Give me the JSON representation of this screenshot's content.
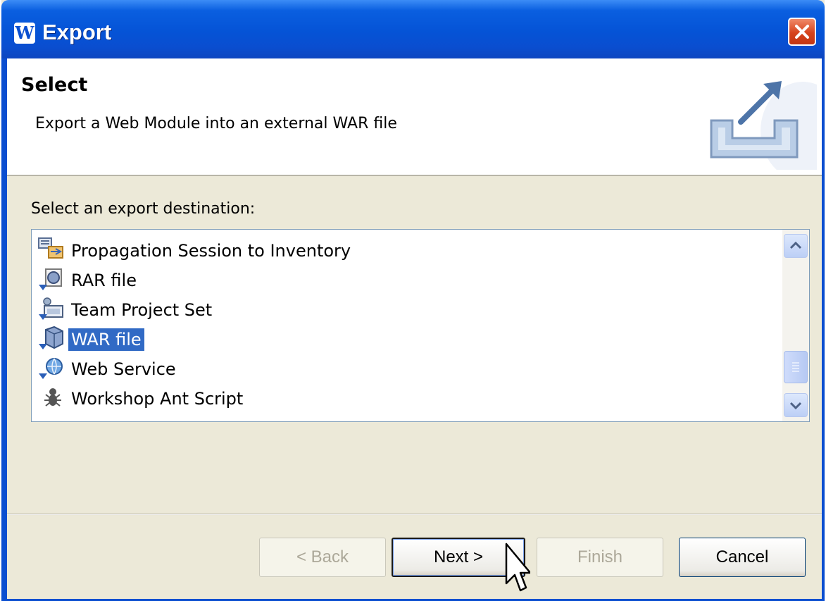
{
  "window": {
    "title": "Export",
    "app_icon_letter": "W"
  },
  "header": {
    "title": "Select",
    "description": "Export a Web Module into an external WAR file",
    "banner_icon": "export-arrow-icon"
  },
  "list": {
    "label": "Select an export destination:",
    "items": [
      {
        "label": "Propagation Session to Inventory",
        "icon": "propagation-icon",
        "selected": false
      },
      {
        "label": "RAR file",
        "icon": "rar-file-icon",
        "selected": false
      },
      {
        "label": "Team Project Set",
        "icon": "team-project-icon",
        "selected": false
      },
      {
        "label": "WAR file",
        "icon": "war-file-icon",
        "selected": true
      },
      {
        "label": "Web Service",
        "icon": "web-service-icon",
        "selected": false
      },
      {
        "label": "Workshop Ant Script",
        "icon": "ant-script-icon",
        "selected": false
      }
    ]
  },
  "buttons": {
    "back": "< Back",
    "next": "Next >",
    "finish": "Finish",
    "cancel": "Cancel"
  },
  "colors": {
    "title_bar": "#0a4ed0",
    "selection": "#316ac5",
    "dialog_bg": "#ece9d8"
  }
}
